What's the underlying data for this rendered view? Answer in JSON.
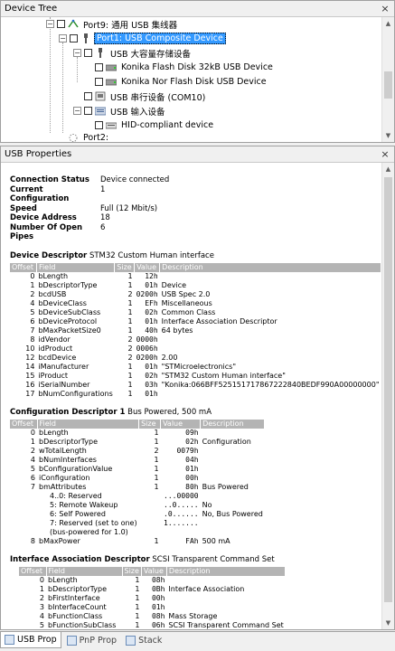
{
  "tree_pane": {
    "title": "Device Tree",
    "items": [
      {
        "label": "Port9: 通用 USB 集线器"
      },
      {
        "label": "Port1: USB Composite Device"
      },
      {
        "label": "USB 大容量存储设备"
      },
      {
        "label": "Konika Flash Disk 32kB USB Device"
      },
      {
        "label": "Konika Nor Flash Disk USB Device"
      },
      {
        "label": "USB 串行设备 (COM10)"
      },
      {
        "label": "USB 输入设备"
      },
      {
        "label": "HID-compliant device"
      },
      {
        "label": "Port2:"
      }
    ]
  },
  "props_pane": {
    "title": "USB Properties",
    "summary": [
      {
        "k": "Connection Status",
        "v": "Device connected"
      },
      {
        "k": "Current Configuration",
        "v": "1"
      },
      {
        "k": "Speed",
        "v": "Full (12 Mbit/s)"
      },
      {
        "k": "Device Address",
        "v": "18"
      },
      {
        "k": "Number Of Open Pipes",
        "v": "6"
      }
    ],
    "device_descriptor": {
      "title": "Device Descriptor",
      "subtitle": "STM32 Custom Human interface",
      "headers": [
        "Offset",
        "Field",
        "Size",
        "Value",
        "Description"
      ],
      "rows": [
        [
          "0",
          "bLength",
          "1",
          "12h",
          ""
        ],
        [
          "1",
          "bDescriptorType",
          "1",
          "01h",
          "Device"
        ],
        [
          "2",
          "bcdUSB",
          "2",
          "0200h",
          "USB Spec 2.0"
        ],
        [
          "4",
          "bDeviceClass",
          "1",
          "EFh",
          "Miscellaneous"
        ],
        [
          "5",
          "bDeviceSubClass",
          "1",
          "02h",
          "Common Class"
        ],
        [
          "6",
          "bDeviceProtocol",
          "1",
          "01h",
          "Interface Association Descriptor"
        ],
        [
          "7",
          "bMaxPacketSize0",
          "1",
          "40h",
          "64 bytes"
        ],
        [
          "8",
          "idVendor",
          "2",
          "0000h",
          ""
        ],
        [
          "10",
          "idProduct",
          "2",
          "0006h",
          ""
        ],
        [
          "12",
          "bcdDevice",
          "2",
          "0200h",
          "2.00"
        ],
        [
          "14",
          "iManufacturer",
          "1",
          "01h",
          "\"STMicroelectronics\""
        ],
        [
          "15",
          "iProduct",
          "1",
          "02h",
          "\"STM32 Custom Human interface\""
        ],
        [
          "16",
          "iSerialNumber",
          "1",
          "03h",
          "\"Konika:066BFF525151717867222840BEDF990A00000000\""
        ],
        [
          "17",
          "bNumConfigurations",
          "1",
          "01h",
          ""
        ]
      ]
    },
    "config_descriptor": {
      "title": "Configuration Descriptor 1",
      "subtitle": "Bus Powered, 500 mA",
      "headers": [
        "Offset",
        "Field",
        "Size",
        "Value",
        "Description"
      ],
      "rows": [
        [
          "0",
          "bLength",
          "1",
          "09h",
          ""
        ],
        [
          "1",
          "bDescriptorType",
          "1",
          "02h",
          "Configuration"
        ],
        [
          "2",
          "wTotalLength",
          "2",
          "0079h",
          ""
        ],
        [
          "4",
          "bNumInterfaces",
          "1",
          "04h",
          ""
        ],
        [
          "5",
          "bConfigurationValue",
          "1",
          "01h",
          ""
        ],
        [
          "6",
          "iConfiguration",
          "1",
          "00h",
          ""
        ],
        [
          "7",
          "bmAttributes",
          "1",
          "80h",
          "Bus Powered"
        ],
        [
          "",
          "4..0: Reserved",
          "",
          "...00000",
          ""
        ],
        [
          "",
          "5: Remote Wakeup",
          "",
          "..0.....",
          "No"
        ],
        [
          "",
          "6: Self Powered",
          "",
          ".0......",
          "No, Bus Powered"
        ],
        [
          "",
          "7: Reserved (set to one)",
          "",
          "1.......",
          ""
        ],
        [
          "",
          "(bus-powered for 1.0)",
          "",
          "",
          ""
        ],
        [
          "8",
          "bMaxPower",
          "1",
          "FAh",
          "500 mA"
        ]
      ]
    },
    "iad_descriptor": {
      "title": "Interface Association Descriptor",
      "subtitle": "SCSI Transparent Command Set",
      "headers": [
        "Offset",
        "Field",
        "Size",
        "Value",
        "Description"
      ],
      "rows": [
        [
          "0",
          "bLength",
          "1",
          "08h",
          ""
        ],
        [
          "1",
          "bDescriptorType",
          "1",
          "0Bh",
          "Interface Association"
        ],
        [
          "2",
          "bFirstInterface",
          "1",
          "00h",
          ""
        ],
        [
          "3",
          "bInterfaceCount",
          "1",
          "01h",
          ""
        ],
        [
          "4",
          "bFunctionClass",
          "1",
          "08h",
          "Mass Storage"
        ],
        [
          "5",
          "bFunctionSubClass",
          "1",
          "06h",
          "SCSI Transparent Command Set"
        ]
      ]
    }
  },
  "tabs": [
    {
      "label": "USB Prop"
    },
    {
      "label": "PnP Prop"
    },
    {
      "label": "Stack"
    }
  ],
  "close_glyph": "×"
}
